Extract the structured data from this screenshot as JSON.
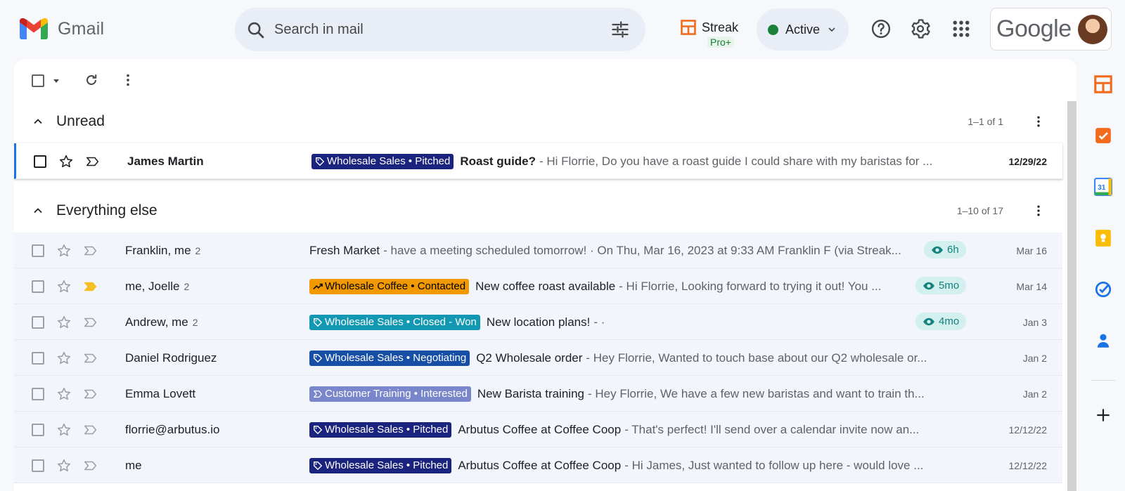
{
  "app": {
    "name": "Gmail"
  },
  "search": {
    "placeholder": "Search in mail"
  },
  "streak": {
    "name": "Streak",
    "badge": "Pro+"
  },
  "status": {
    "label": "Active"
  },
  "account": {
    "logo": "Google"
  },
  "sections": [
    {
      "title": "Unread",
      "count": "1–1 of 1"
    },
    {
      "title": "Everything else",
      "count": "1–10 of 17"
    }
  ],
  "unread_emails": [
    {
      "sender": "James Martin",
      "tag": "Wholesale Sales • Pitched",
      "tag_color": "#1a237e",
      "tag_icon": "tag-icon",
      "subject": "Roast guide?",
      "snippet": " - Hi Florrie, Do you have a roast guide I could share with my baristas for ...",
      "date": "12/29/22"
    }
  ],
  "emails": [
    {
      "sender": "Franklin, me",
      "count": "2",
      "tag": "",
      "subject": "Fresh Market",
      "snippet": " - have a meeting scheduled tomorrow! · On Thu, Mar 16, 2023 at 9:33 AM Franklin F (via Streak...",
      "views": "6h",
      "date": "Mar 16",
      "important": false
    },
    {
      "sender": "me, Joelle",
      "count": "2",
      "tag": "Wholesale Coffee • Contacted",
      "tag_color": "#f29900",
      "tag_icon": "trend-icon",
      "subject": "New coffee roast available",
      "snippet": " - Hi Florrie, Looking forward to trying it out! You ...",
      "views": "5mo",
      "date": "Mar 14",
      "important": true
    },
    {
      "sender": "Andrew, me",
      "count": "2",
      "tag": "Wholesale Sales • Closed - Won",
      "tag_color": "#1298b3",
      "tag_icon": "tag-icon",
      "subject": "New location plans!",
      "snippet": " - ·",
      "views": "4mo",
      "date": "Jan 3",
      "important": false
    },
    {
      "sender": "Daniel Rodriguez",
      "count": "",
      "tag": "Wholesale Sales • Negotiating",
      "tag_color": "#174ea6",
      "tag_icon": "tag-icon",
      "subject": "Q2 Wholesale order",
      "snippet": " - Hey Florrie, Wanted to touch base about our Q2 wholesale or...",
      "views": "",
      "date": "Jan 2",
      "important": false
    },
    {
      "sender": "Emma Lovett",
      "count": "",
      "tag": "Customer Training • Interested",
      "tag_color": "#7986cb",
      "tag_icon": "chevron-icon",
      "subject": "New Barista training",
      "snippet": " - Hey Florrie, We have a few new baristas and want to train th...",
      "views": "",
      "date": "Jan 2",
      "important": false
    },
    {
      "sender": "florrie@arbutus.io",
      "count": "",
      "tag": "Wholesale Sales • Pitched",
      "tag_color": "#1a237e",
      "tag_icon": "tag-icon",
      "subject": "Arbutus Coffee at Coffee Coop",
      "snippet": " - That's perfect! I'll send over a calendar invite now an...",
      "views": "",
      "date": "12/12/22",
      "important": false
    },
    {
      "sender": "me",
      "count": "",
      "tag": "Wholesale Sales • Pitched",
      "tag_color": "#1a237e",
      "tag_icon": "tag-icon",
      "subject": "Arbutus Coffee at Coffee Coop",
      "snippet": " - Hi James, Just wanted to follow up here - would love ...",
      "views": "",
      "date": "12/12/22",
      "important": false
    }
  ],
  "rail": {
    "calendar_day": "31"
  }
}
